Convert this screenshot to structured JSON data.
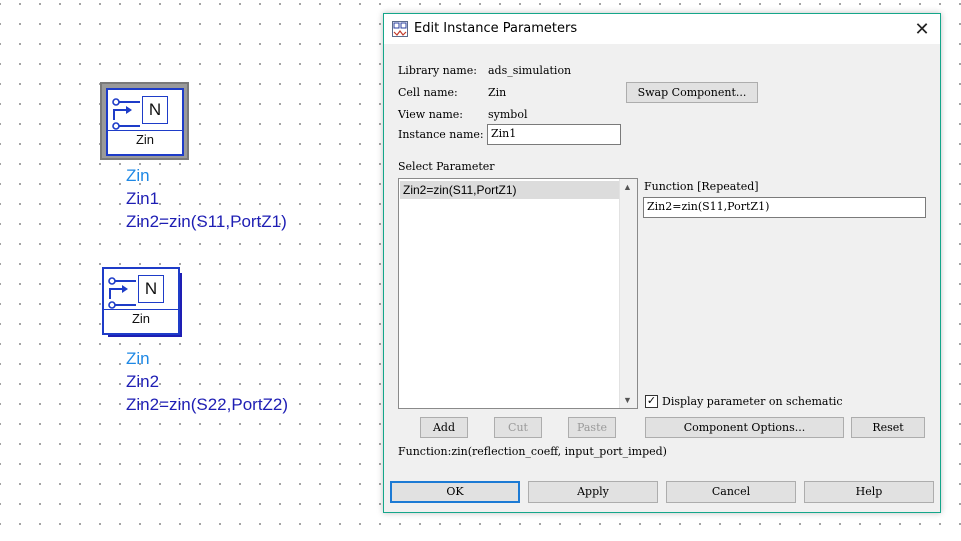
{
  "schematic": {
    "components": [
      {
        "label": "Zin",
        "annotation": [
          "Zin",
          "Zin1",
          "Zin2=zin(S11,PortZ1)"
        ]
      },
      {
        "label": "Zin",
        "annotation": [
          "Zin",
          "Zin2",
          "Zin2=zin(S22,PortZ2)"
        ]
      }
    ],
    "symbol_letter": "N"
  },
  "dialog": {
    "title": "Edit Instance Parameters",
    "library_name_label": "Library name:",
    "library_name": "ads_simulation",
    "cell_name_label": "Cell name:",
    "cell_name": "Zin",
    "view_name_label": "View name:",
    "view_name": "symbol",
    "instance_name_label": "Instance name:",
    "instance_name": "Zin1",
    "swap_button": "Swap Component...",
    "select_parameter_label": "Select Parameter",
    "parameters": [
      "Zin2=zin(S11,PortZ1)"
    ],
    "function_label": "Function [Repeated]",
    "function_value": "Zin2=zin(S11,PortZ1)",
    "display_checkbox_label": "Display parameter on schematic",
    "display_checked": true,
    "add_button": "Add",
    "cut_button": "Cut",
    "paste_button": "Paste",
    "component_options_button": "Component Options...",
    "reset_button": "Reset",
    "function_help": "Function:zin(reflection_coeff, input_port_imped)",
    "ok_button": "OK",
    "apply_button": "Apply",
    "cancel_button": "Cancel",
    "help_button": "Help",
    "accent_color": "#14a68a"
  }
}
